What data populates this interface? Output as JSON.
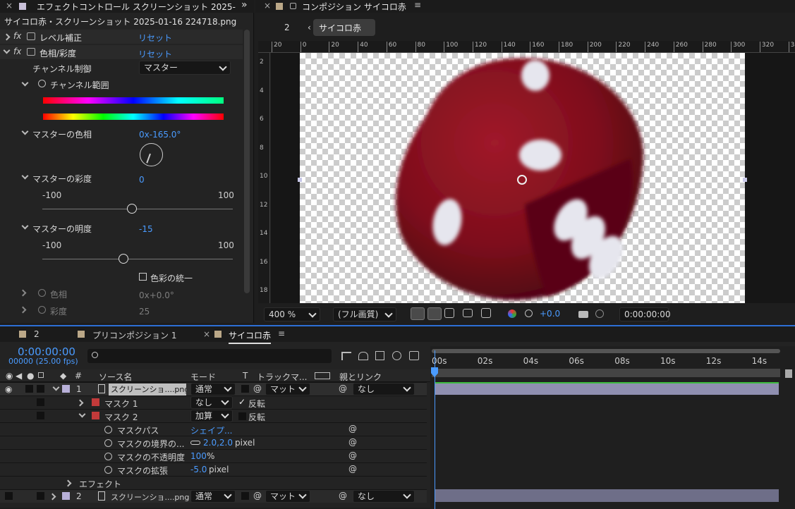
{
  "effect_panel": {
    "tab_title": "エフェクトコントロール スクリーンショット 2025-",
    "expand_icon": "»",
    "layer_path": "サイコロ赤・スクリーンショット 2025-01-16 224718.png",
    "effects": [
      {
        "fx": "fx",
        "name": "レベル補正",
        "reset": "リセット"
      },
      {
        "fx": "fx",
        "name": "色相/彩度",
        "reset": "リセット"
      }
    ],
    "channel_control": {
      "label": "チャンネル制御",
      "value": "マスター"
    },
    "channel_range": {
      "label": "チャンネル範囲"
    },
    "master_hue": {
      "label": "マスターの色相",
      "value": "0x-165.0°"
    },
    "master_sat": {
      "label": "マスターの彩度",
      "value": "0",
      "min": "-100",
      "max": "100",
      "level": 0.47
    },
    "master_light": {
      "label": "マスターの明度",
      "value": "-15",
      "min": "-100",
      "max": "100",
      "level": 0.425
    },
    "colorize": {
      "label": "色彩の統一",
      "checked": false
    },
    "hue": {
      "label": "色相",
      "value": "0x+0.0°"
    },
    "saturation": {
      "label": "彩度",
      "value": "25"
    }
  },
  "comp_panel": {
    "close": "×",
    "title": "コンポジション サイコロ赤",
    "menu": "≡",
    "nav_index": "2",
    "crumb": "サイコロ赤",
    "ruler_top": [
      "20",
      "0",
      "20",
      "40",
      "60",
      "80",
      "100",
      "120",
      "140",
      "160",
      "180",
      "200",
      "220",
      "240",
      "260",
      "280",
      "300",
      "320",
      "340"
    ],
    "ruler_left": [
      "2",
      "4",
      "6",
      "8",
      "10",
      "12",
      "14",
      "16",
      "18"
    ],
    "zoom": "400 %",
    "quality": "(フル画質)",
    "exposure": "+0.0",
    "timecode": "0:00:00:00"
  },
  "timeline": {
    "tabs": [
      {
        "label": "2"
      },
      {
        "label": "プリコンポジション 1"
      },
      {
        "label": "サイコロ赤",
        "active": true
      }
    ],
    "timecode": "0:00:00:00",
    "frames": "00000 (25.00 fps)",
    "search_placeholder": "",
    "headers": {
      "hash": "#",
      "source": "ソース名",
      "mode": "モード",
      "t": "T",
      "track": "トラックマ...",
      "parent": "親とリンク"
    },
    "ruler": [
      "00s",
      "02s",
      "04s",
      "06s",
      "08s",
      "10s",
      "12s",
      "14s"
    ],
    "layer1": {
      "num": "1",
      "name": "スクリーンショ....png",
      "mode": "通常",
      "track": "マット",
      "parent": "なし"
    },
    "mask1": {
      "name": "マスク 1",
      "mode": "なし",
      "invert": "反転",
      "inverted": true
    },
    "mask2": {
      "name": "マスク 2",
      "mode": "加算",
      "invert": "反転",
      "inverted": false
    },
    "mask_path": {
      "label": "マスクパス",
      "value": "シェイプ..."
    },
    "mask_feather": {
      "label": "マスクの境界の...",
      "value": "2.0,2.0",
      "unit": "pixel"
    },
    "mask_opacity": {
      "label": "マスクの不透明度",
      "value": "100",
      "unit": "%"
    },
    "mask_expansion": {
      "label": "マスクの拡張",
      "value": "-5.0",
      "unit": "pixel"
    },
    "effects_label": "エフェクト",
    "layer2": {
      "num": "2",
      "name": "スクリーンショ....png",
      "mode": "通常",
      "track": "マット",
      "parent": "なし"
    }
  },
  "colors": {
    "accent": "#4a9bff",
    "bg": "#1d1d1d",
    "layer_bar": "#8f8fb0",
    "dice": "#8a1420"
  }
}
